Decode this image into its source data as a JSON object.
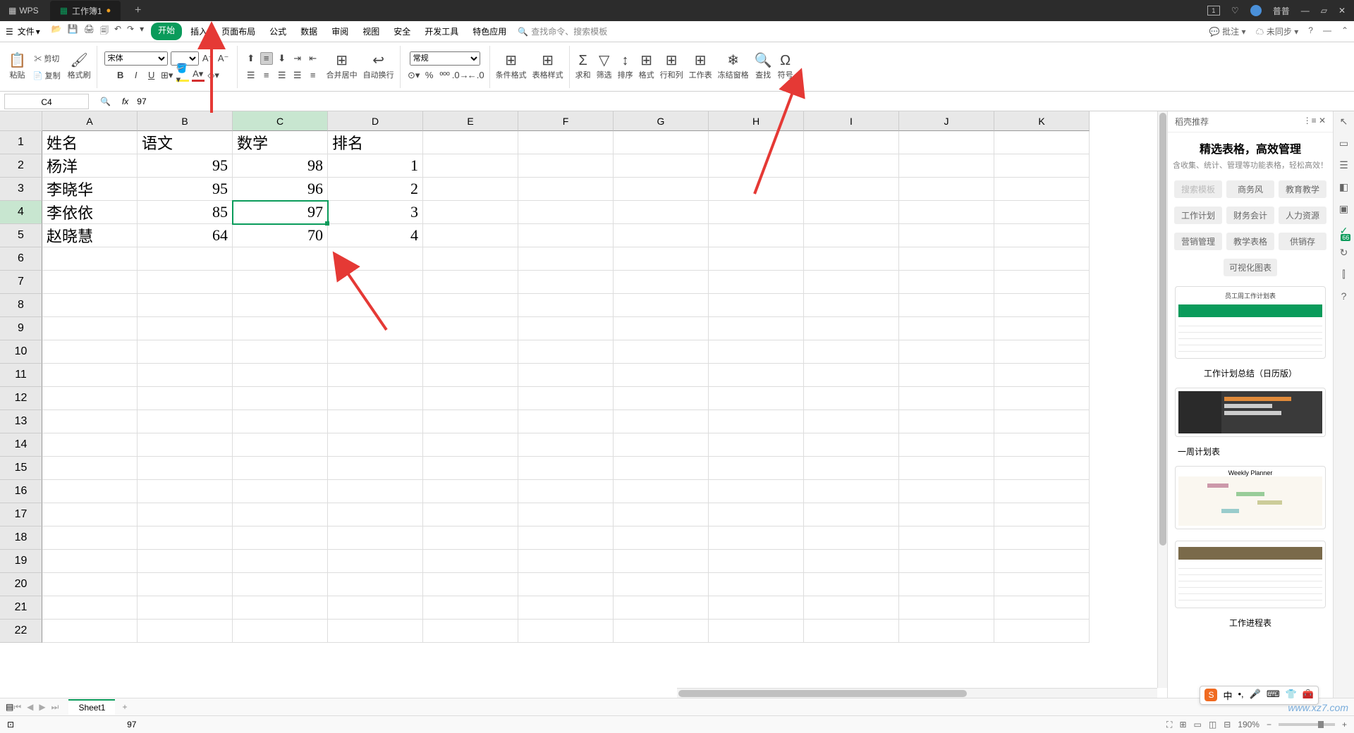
{
  "titlebar": {
    "app": "WPS",
    "tab": "工作簿1",
    "num_box": "1",
    "user": "普普"
  },
  "menubar": {
    "file": "文件",
    "tabs": [
      "开始",
      "插入",
      "页面布局",
      "公式",
      "数据",
      "审阅",
      "视图",
      "安全",
      "开发工具",
      "特色应用"
    ],
    "search_placeholder": "查找命令、搜索模板",
    "right": [
      "批注",
      "未同步"
    ]
  },
  "ribbon": {
    "paste": "粘贴",
    "cut": "剪切",
    "copy": "复制",
    "format_painter": "格式刷",
    "font_name": "宋体",
    "font_size": "",
    "merge": "合并居中",
    "wrap": "自动换行",
    "number_format": "常规",
    "cond_format": "条件格式",
    "table_style": "表格样式",
    "sum": "求和",
    "filter": "筛选",
    "sort": "排序",
    "format": "格式",
    "rowcol": "行和列",
    "worksheet": "工作表",
    "freeze": "冻结窗格",
    "find": "查找",
    "symbol": "符号"
  },
  "formula": {
    "cell": "C4",
    "value": "97"
  },
  "columns": [
    "A",
    "B",
    "C",
    "D",
    "E",
    "F",
    "G",
    "H",
    "I",
    "J",
    "K"
  ],
  "row_nums": [
    1,
    2,
    3,
    4,
    5,
    6,
    7,
    8,
    9,
    10,
    11,
    12,
    13,
    14,
    15,
    16,
    17,
    18,
    19,
    20,
    21,
    22
  ],
  "sheet_data": {
    "A1": "姓名",
    "B1": "语文",
    "C1": "数学",
    "D1": "排名",
    "A2": "杨洋",
    "B2": "95",
    "C2": "98",
    "D2": "1",
    "A3": "李晓华",
    "B3": "95",
    "C3": "96",
    "D3": "2",
    "A4": "李依依",
    "B4": "85",
    "C4": "97",
    "D4": "3",
    "A5": "赵晓慧",
    "B5": "64",
    "C5": "70",
    "D5": "4"
  },
  "side": {
    "title": "稻壳推荐",
    "headline": "精选表格，高效管理",
    "sub": "含收集、统计、管理等功能表格，轻松高效！",
    "tabs1": [
      "搜索模板",
      "商务风",
      "教育教学"
    ],
    "tabs2": [
      "工作计划",
      "财务会计",
      "人力资源"
    ],
    "tabs3": [
      "营销管理",
      "教学表格",
      "供销存"
    ],
    "tabs4": [
      "可视化图表"
    ],
    "tpl1": "员工周工作计划表",
    "tpl2": "工作计划总结（日历版）",
    "tpl3": "一周计划表",
    "tpl3b": "Weekly Planner",
    "tpl5": "工作进程表"
  },
  "sheets": {
    "name": "Sheet1"
  },
  "status": {
    "cellval": "97",
    "zoom": "190%"
  },
  "ime": {
    "lang": "中"
  },
  "badge66": "66",
  "watermark": "www.xz7.com"
}
